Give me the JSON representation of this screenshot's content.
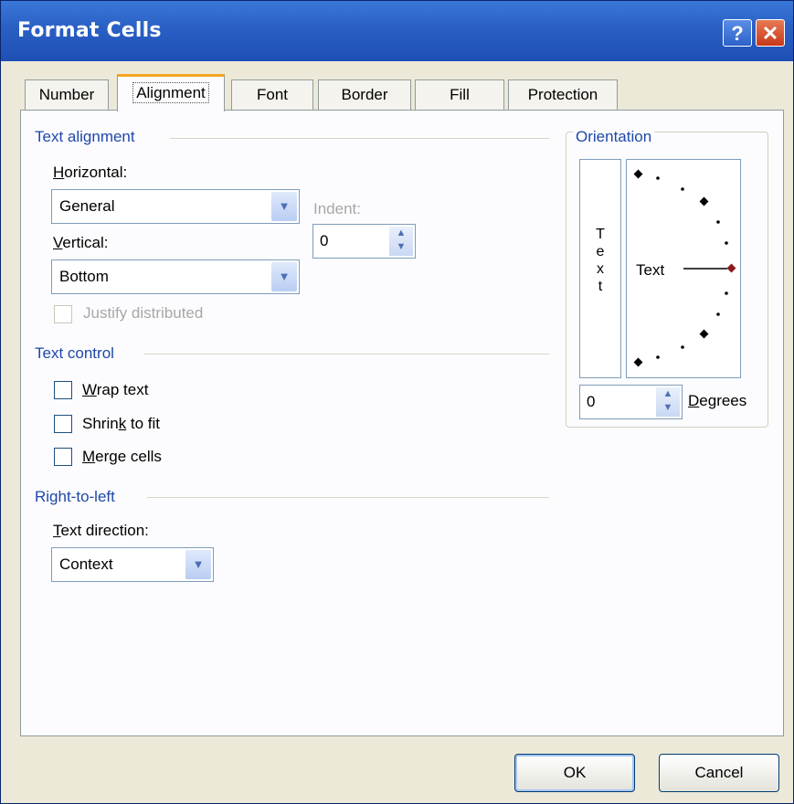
{
  "dialog": {
    "title": "Format Cells",
    "help_label": "?",
    "close_label": "✕"
  },
  "tabs": [
    "Number",
    "Alignment",
    "Font",
    "Border",
    "Fill",
    "Protection"
  ],
  "active_tab": "Alignment",
  "text_alignment": {
    "group_label": "Text alignment",
    "horizontal": {
      "accesskey": "H",
      "label_rest": "orizontal:",
      "value": "General"
    },
    "vertical": {
      "accesskey": "V",
      "label_rest": "ertical:",
      "value": "Bottom"
    },
    "indent": {
      "label": "Indent:",
      "value": "0"
    },
    "justify_distributed": {
      "label": "Justify distributed",
      "checked": false,
      "enabled": false
    }
  },
  "text_control": {
    "group_label": "Text control",
    "wrap": {
      "accesskey": "W",
      "label_rest": "rap text",
      "checked": false
    },
    "shrink": {
      "label_pre": "Shrin",
      "accesskey": "k",
      "label_rest": " to fit",
      "checked": false
    },
    "merge": {
      "accesskey": "M",
      "label_rest": "erge cells",
      "checked": false
    }
  },
  "rtl": {
    "group_label": "Right-to-left",
    "direction": {
      "accesskey": "T",
      "label_rest": "ext direction:",
      "value": "Context"
    }
  },
  "orientation": {
    "group_label": "Orientation",
    "vertical_text": "T\ne\nx\nt",
    "dial_text": "Text",
    "degrees_value": "0",
    "degrees": {
      "accesskey": "D",
      "label_rest": "egrees"
    }
  },
  "buttons": {
    "ok": "OK",
    "cancel": "Cancel"
  },
  "colors": {
    "title_bar": "#2a5fc4",
    "group_label": "#1e48a8",
    "active_tab_accent": "#f5a623",
    "dial_marker": "#8b1a1a"
  },
  "icons": [
    "help-icon",
    "close-icon",
    "chevron-down-icon",
    "spin-up-down-icon"
  ]
}
